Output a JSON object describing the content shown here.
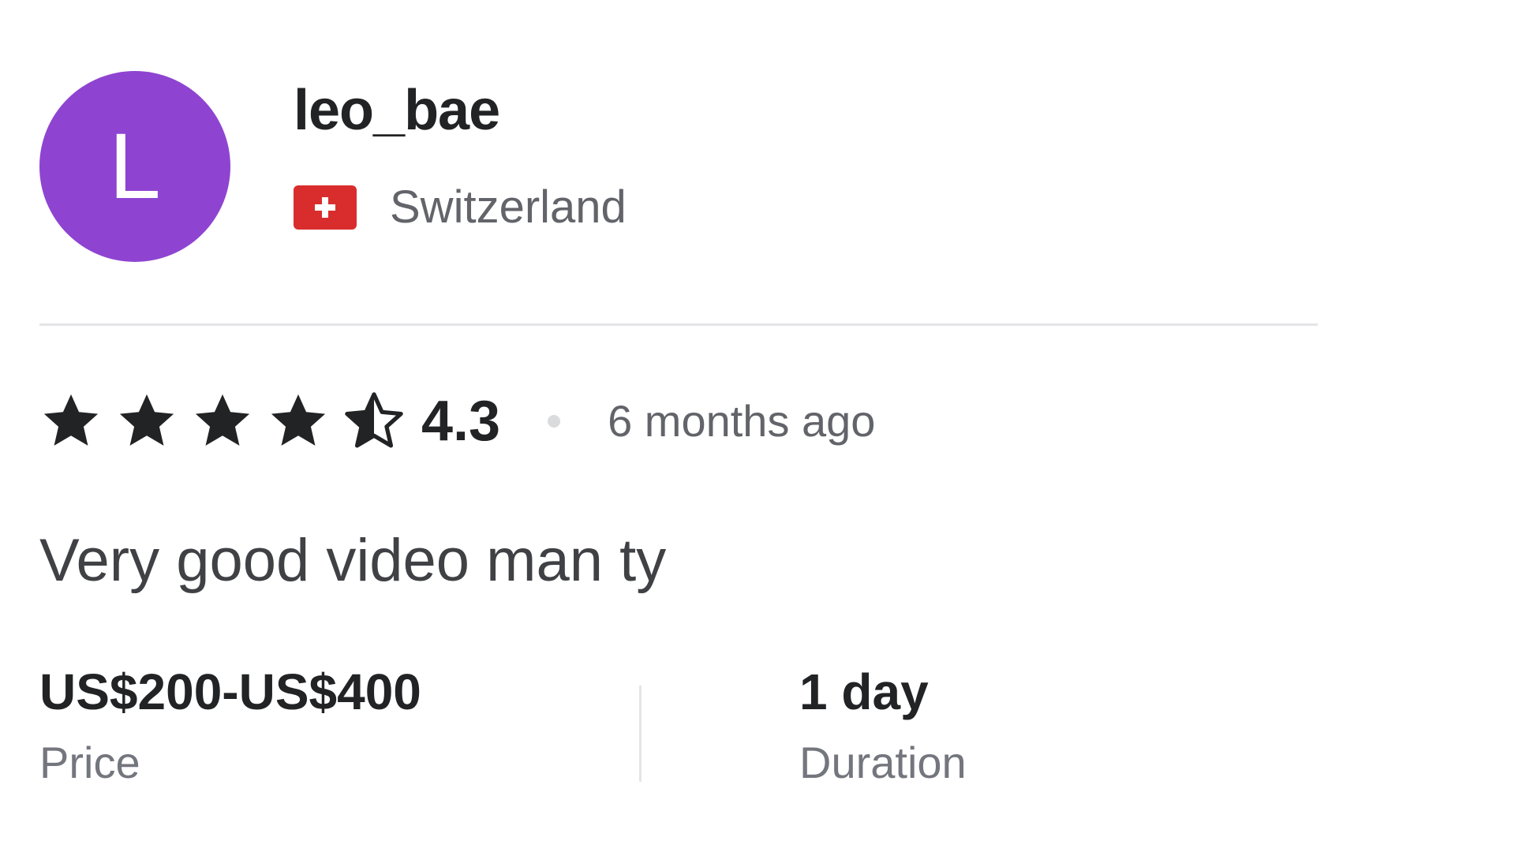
{
  "reviewer": {
    "avatar_initial": "L",
    "avatar_color": "#8e44d1",
    "username": "leo_bae",
    "country": "Switzerland",
    "flag_icon": "switzerland-flag-icon"
  },
  "rating": {
    "value": "4.3",
    "stars_filled": 4,
    "stars_half": 1,
    "stars_total": 5,
    "time_ago": "6 months ago"
  },
  "review": {
    "text": "Very good video man ty"
  },
  "meta": {
    "price_value": "US$200-US$400",
    "price_label": "Price",
    "duration_value": "1 day",
    "duration_label": "Duration"
  }
}
